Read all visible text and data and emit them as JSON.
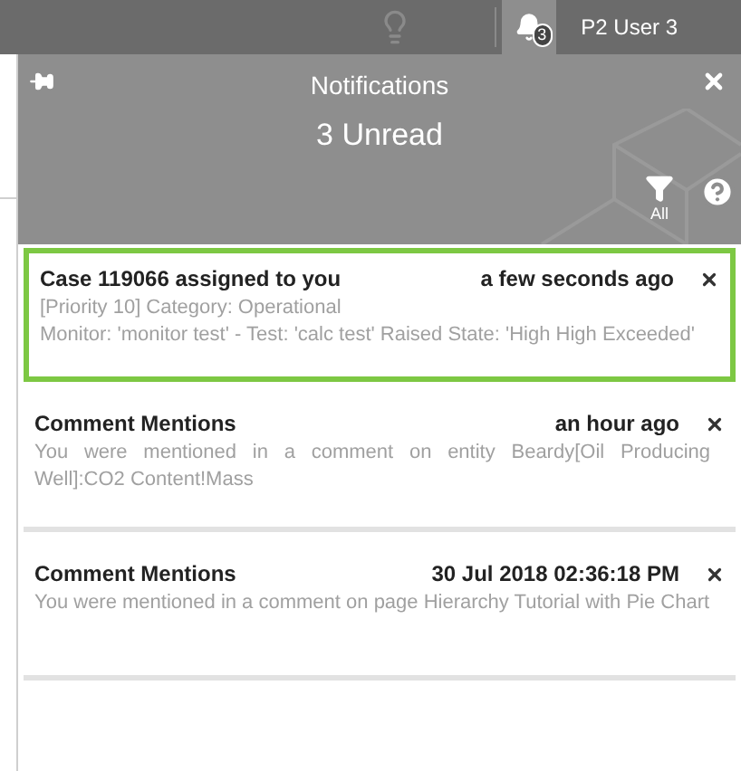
{
  "topbar": {
    "notification_count": "3",
    "user": "P2 User 3"
  },
  "panel": {
    "title": "Notifications",
    "subtitle": "3 Unread",
    "filter_label": "All"
  },
  "notifications": [
    {
      "title": "Case 119066 assigned to you",
      "time": "a few seconds ago",
      "body": [
        "[Priority 10] Category: Operational",
        "Monitor: 'monitor test' - Test: 'calc test' Raised State: 'High High Exceeded'"
      ],
      "selected": true
    },
    {
      "title": "Comment Mentions",
      "time": "an hour ago",
      "body": [
        "You were mentioned in a comment on entity Beardy[Oil Producing Well]:CO2 Content!Mass"
      ],
      "selected": false
    },
    {
      "title": "Comment Mentions",
      "time": "30 Jul 2018 02:36:18 PM",
      "body": [
        "You were mentioned in a comment on page Hierarchy Tutorial with Pie Chart"
      ],
      "selected": false
    }
  ]
}
